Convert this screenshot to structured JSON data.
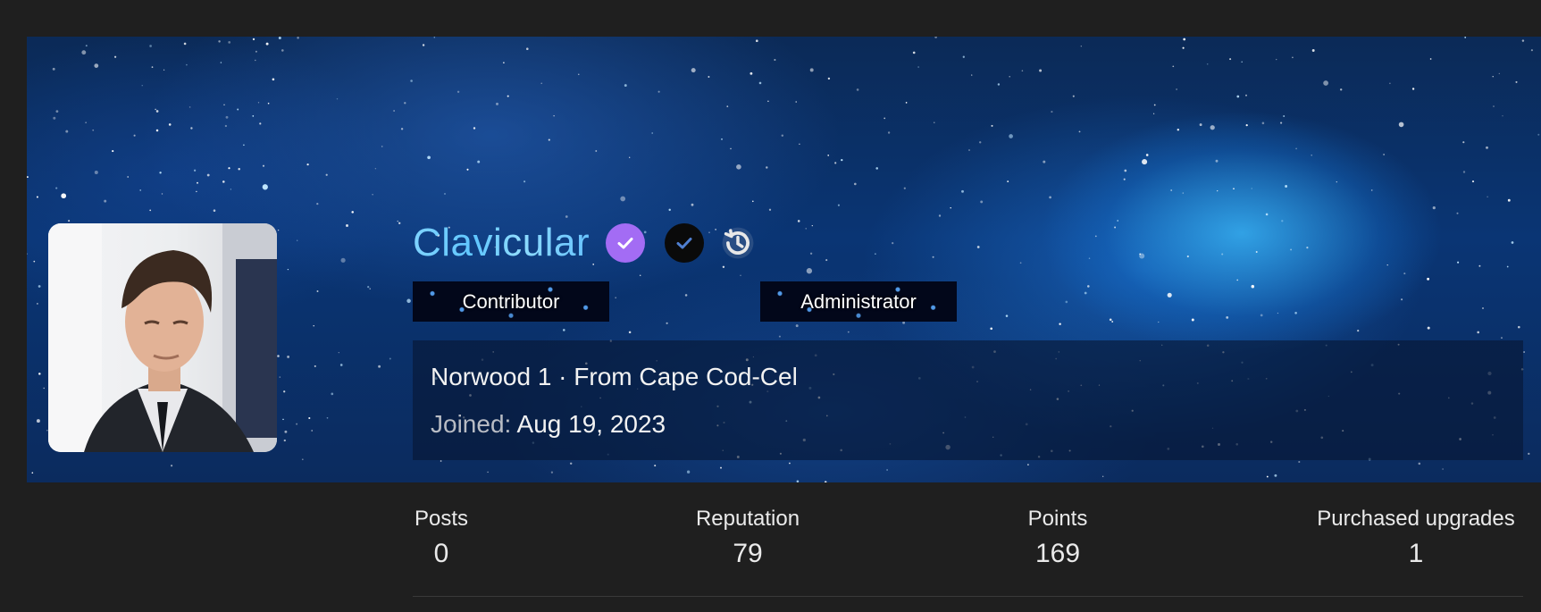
{
  "profile": {
    "username": "Clavicular",
    "roles": [
      "Contributor",
      "Administrator"
    ],
    "location_line": "Norwood 1 · From Cape Cod-Cel",
    "joined_label": "Joined:",
    "joined_value": "Aug 19, 2023"
  },
  "icons": {
    "verified": "check-circle-icon",
    "verified_alt": "check-circle-icon",
    "history": "history-icon"
  },
  "stats": [
    {
      "label": "Posts",
      "value": "0"
    },
    {
      "label": "Reputation",
      "value": "79"
    },
    {
      "label": "Points",
      "value": "169"
    },
    {
      "label": "Purchased upgrades",
      "value": "1"
    }
  ],
  "colors": {
    "background": "#1f1f1f",
    "username_gradient": "#6fcaff",
    "verified_badge": "#a36cf4",
    "role_badge_bg": "#02071a"
  }
}
